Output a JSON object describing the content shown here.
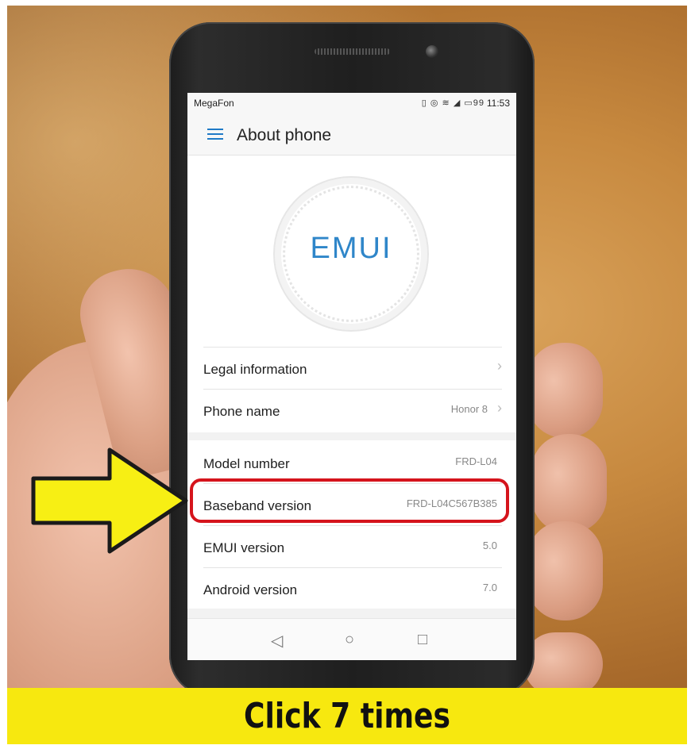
{
  "statusbar": {
    "carrier": "MegaFon",
    "icons": "vibrate-icon eye-icon wifi-icon signal-icon battery-icon",
    "battery": "99",
    "time": "11:53"
  },
  "appbar": {
    "title": "About phone"
  },
  "logo": {
    "text": "EMUI",
    "color": "#2f86c9"
  },
  "rows_group1": [
    {
      "label": "Legal information",
      "value": ""
    },
    {
      "label": "Phone name",
      "value": "Honor 8"
    }
  ],
  "rows_group2": [
    {
      "label": "Model number",
      "value": "FRD-L04"
    },
    {
      "label": "Baseband version",
      "value": "FRD-L04C567B385"
    },
    {
      "label": "EMUI version",
      "value": "5.0"
    },
    {
      "label": "Android version",
      "value": "7.0"
    }
  ],
  "navbar": {
    "back": "◁",
    "home": "○",
    "recent": "□"
  },
  "annotation": {
    "caption": "Click 7 times",
    "highlight_color": "#d5141c",
    "arrow_color": "#f7ef14"
  }
}
